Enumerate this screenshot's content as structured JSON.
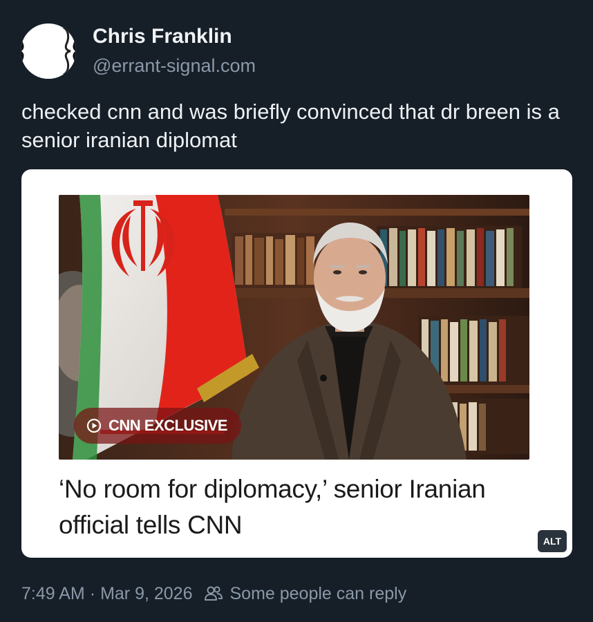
{
  "author": {
    "display_name": "Chris Franklin",
    "handle": "@errant-signal.com",
    "avatar_icon": "curly-braces-avatar-icon"
  },
  "post": {
    "text": "checked cnn and was briefly convinced that dr breen is a senior iranian diplomat"
  },
  "embed": {
    "badge_label": "CNN EXCLUSIVE",
    "badge_icon": "play-circle-icon",
    "headline": "‘No room for diplomacy,’ senior Iranian official tells CNN",
    "alt_label": "ALT"
  },
  "footer": {
    "time": "7:49 AM",
    "separator": "·",
    "date": "Mar 9, 2026",
    "reply_icon": "people-icon",
    "reply_setting": "Some people can reply"
  },
  "colors": {
    "background": "#161e27",
    "primary_text": "#f1f3f5",
    "secondary_text": "#8a98a8",
    "card_background": "#ffffff",
    "badge_background": "#781414",
    "flag_red": "#e2231a"
  }
}
